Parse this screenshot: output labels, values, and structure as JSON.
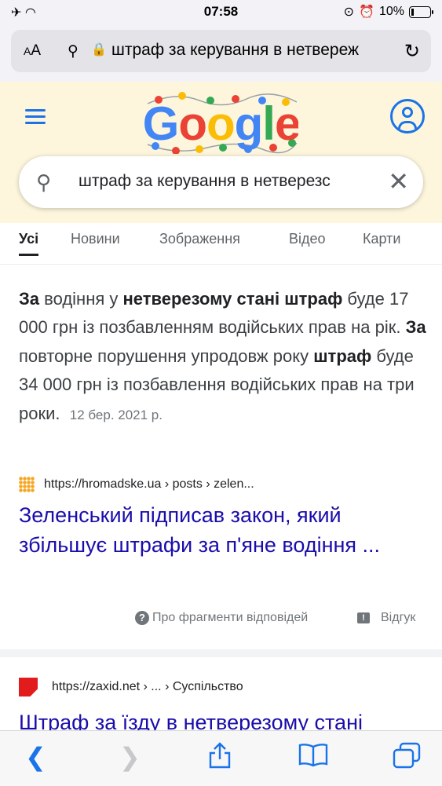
{
  "status_bar": {
    "time": "07:58",
    "battery": "10%"
  },
  "address_bar": {
    "text_size_label": "AA",
    "url": "штраф за керування в нетвереж"
  },
  "google": {
    "logo_text": "Google",
    "search_query": "штраф за керування в нетверезс"
  },
  "tabs": [
    "Усі",
    "Новини",
    "Зображення",
    "Відео",
    "Карти"
  ],
  "featured_snippet": {
    "segments": [
      {
        "t": "За",
        "b": true
      },
      {
        "t": " водіння у ",
        "b": false
      },
      {
        "t": "нетверезому стані штраф",
        "b": true
      },
      {
        "t": " буде 17 000 грн із позбавленням водійських прав на рік. ",
        "b": false
      },
      {
        "t": "За",
        "b": true
      },
      {
        "t": " повторне порушення упродовж року ",
        "b": false
      },
      {
        "t": "штраф",
        "b": true
      },
      {
        "t": " буде 34 000 грн із позбавлення водійських прав на три роки.",
        "b": false
      }
    ],
    "date": "12 бер. 2021 р.",
    "source_url": "https://hromadske.ua › posts › zelen...",
    "title": "Зеленський підписав закон, який збільшує штрафи за п'яне водіння ...",
    "about_label": "Про фрагменти відповідей",
    "feedback_label": "Відгук"
  },
  "result2": {
    "source_url": "https://zaxid.net › ... › Суспільство",
    "title": "Штраф за їзду в нетверезому стані"
  }
}
